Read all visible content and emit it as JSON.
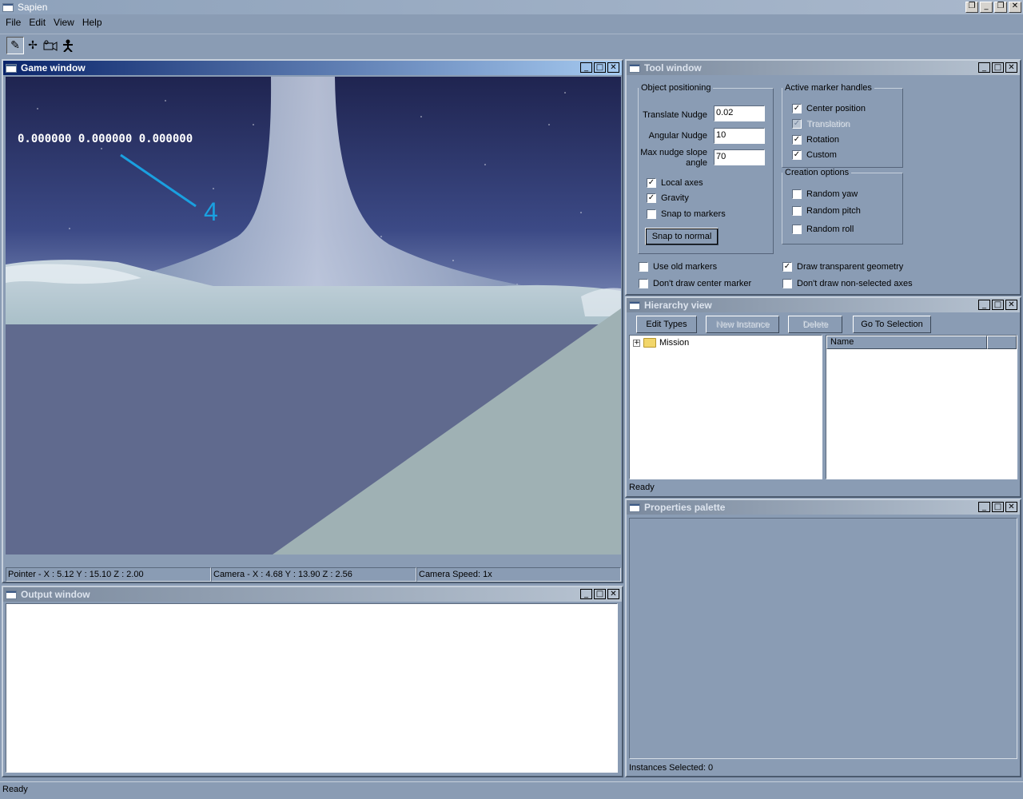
{
  "app": {
    "title": "Sapien",
    "status": "Ready"
  },
  "menu": [
    "File",
    "Edit",
    "View",
    "Help"
  ],
  "toolbar": {
    "icons": [
      "pencil-icon",
      "crosshair-icon",
      "camera-icon",
      "actor-icon"
    ]
  },
  "game_window": {
    "title": "Game window",
    "coords_overlay": "0.000000 0.000000 0.000000",
    "annotation": "4",
    "annotation_color": "#1aa0e0",
    "status": {
      "pointer": "Pointer - X : 5.12  Y : 15.10  Z : 2.00",
      "camera": "Camera - X : 4.68  Y : 13.90  Z : 2.56",
      "speed": "Camera Speed: 1x"
    }
  },
  "output_window": {
    "title": "Output window"
  },
  "tool_window": {
    "title": "Tool window",
    "object_positioning": {
      "legend": "Object positioning",
      "translate_label": "Translate Nudge",
      "translate_value": "0.02",
      "angular_label": "Angular Nudge",
      "angular_value": "10",
      "slope_label_1": "Max nudge slope",
      "slope_label_2": "angle",
      "slope_value": "70",
      "local_axes": "Local axes",
      "gravity": "Gravity",
      "snap_markers": "Snap to markers",
      "snap_normal": "Snap to normal"
    },
    "marker_handles": {
      "legend": "Active marker handles",
      "center": "Center position",
      "translation": "Translation",
      "rotation": "Rotation",
      "custom": "Custom"
    },
    "creation": {
      "legend": "Creation options",
      "yaw": "Random yaw",
      "pitch": "Random pitch",
      "roll": "Random roll"
    },
    "misc": {
      "use_old_markers": "Use old markers",
      "dont_draw_center": "Don't draw center marker",
      "draw_transparent": "Draw transparent geometry",
      "dont_draw_axes": "Don't draw non-selected axes"
    }
  },
  "hierarchy_view": {
    "title": "Hierarchy view",
    "buttons": {
      "edit_types": "Edit Types",
      "new_instance": "New Instance",
      "delete": "Delete",
      "go_to_selection": "Go To Selection"
    },
    "tree_root": "Mission",
    "column_name": "Name",
    "status": "Ready"
  },
  "properties_palette": {
    "title": "Properties palette",
    "status": "Instances Selected: 0"
  }
}
